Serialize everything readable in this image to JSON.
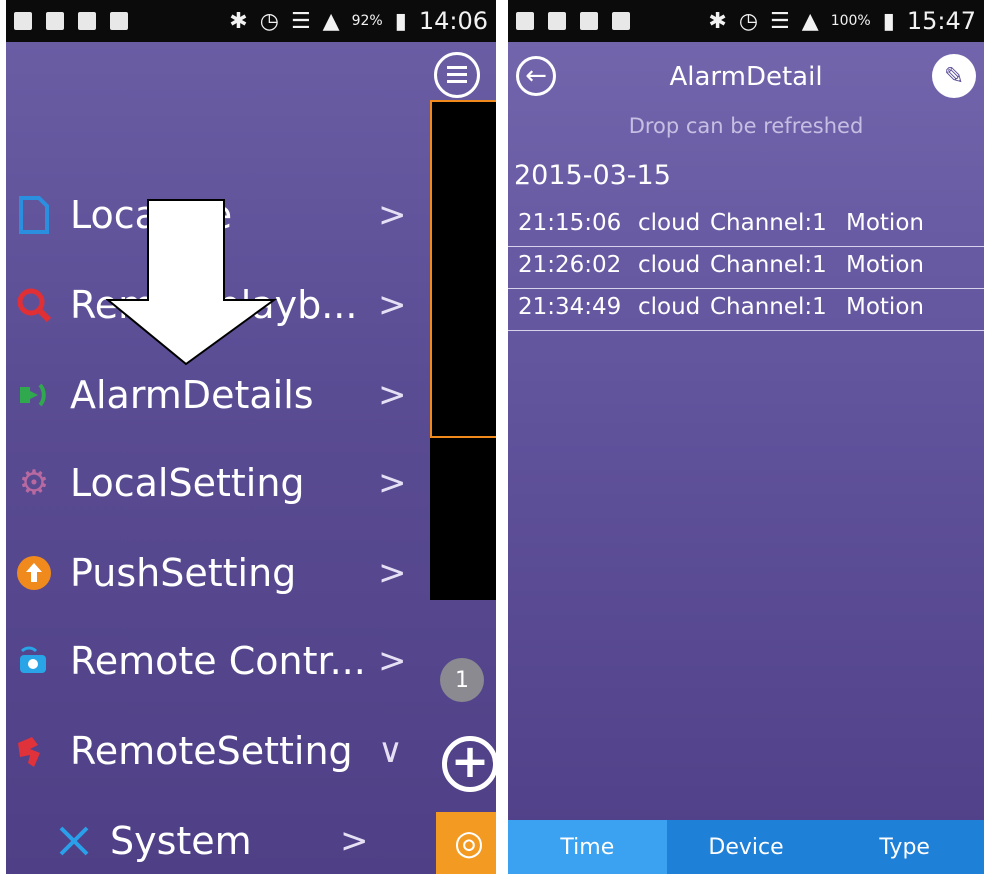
{
  "left": {
    "status": {
      "percent": "92%",
      "time": "14:06"
    },
    "menu": [
      {
        "label": "LocalFile",
        "icon": "file-icon",
        "color": "#2b8fe0",
        "expanded": false
      },
      {
        "label": "Remoteplayb...",
        "icon": "search-icon",
        "color": "#e02f35",
        "expanded": false
      },
      {
        "label": "AlarmDetails",
        "icon": "alarm-icon",
        "color": "#2fa84e",
        "expanded": false
      },
      {
        "label": "LocalSetting",
        "icon": "gear-icon",
        "color": "#b86aa0",
        "expanded": false
      },
      {
        "label": "PushSetting",
        "icon": "push-icon",
        "color": "#f08a1c",
        "expanded": false
      },
      {
        "label": "Remote Contr...",
        "icon": "remote-control-icon",
        "color": "#29a4e6",
        "expanded": false
      },
      {
        "label": "RemoteSetting",
        "icon": "remote-setting-icon",
        "color": "#e0323b",
        "expanded": true
      },
      {
        "label": "System",
        "icon": "wrench-icon",
        "color": "#2aa0ea",
        "expanded": false
      }
    ],
    "badge": "1",
    "chevron_right": ">",
    "chevron_down": "∨"
  },
  "right": {
    "status": {
      "percent": "100%",
      "time": "15:47"
    },
    "title": "AlarmDetail",
    "hint": "Drop can be refreshed",
    "date": "2015-03-15",
    "rows": [
      {
        "time": "21:15:06",
        "source": "cloud",
        "channel": "Channel:1",
        "type": "Motion"
      },
      {
        "time": "21:26:02",
        "source": "cloud",
        "channel": "Channel:1",
        "type": "Motion"
      },
      {
        "time": "21:34:49",
        "source": "cloud",
        "channel": "Channel:1",
        "type": "Motion"
      }
    ],
    "tabs": [
      "Time",
      "Device",
      "Type"
    ],
    "active_tab": "Time"
  }
}
